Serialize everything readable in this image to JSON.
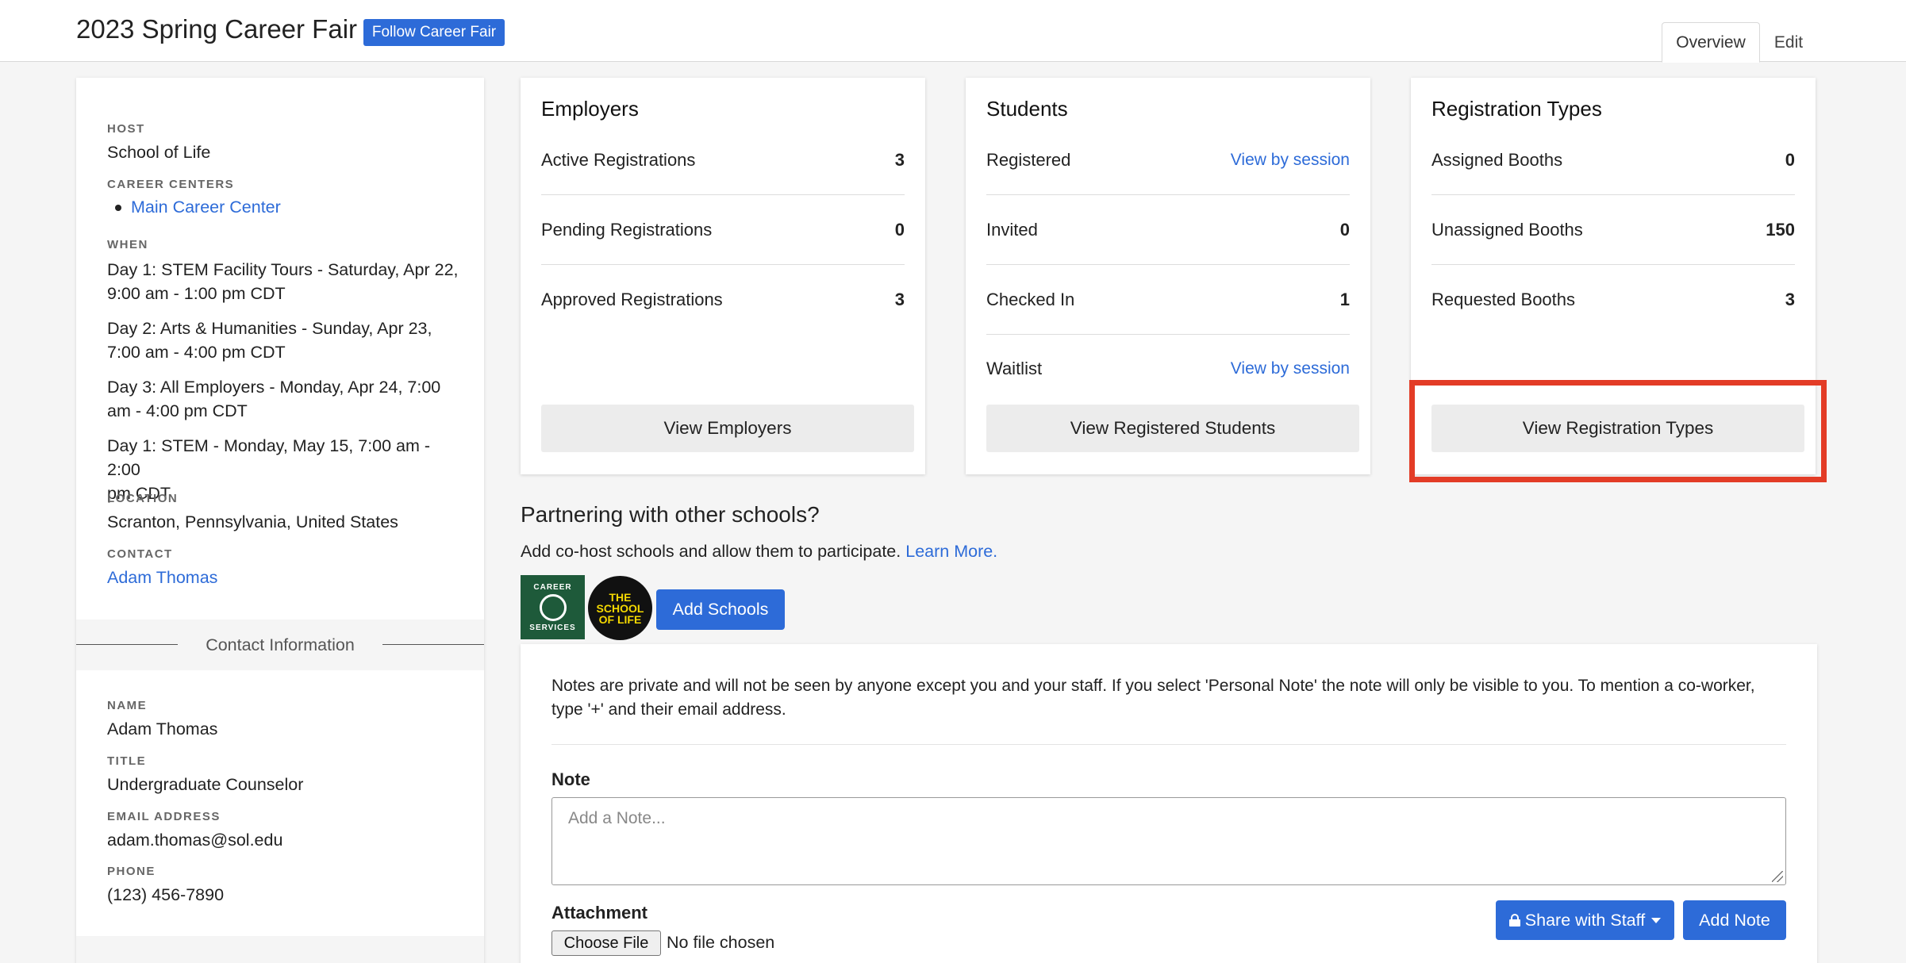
{
  "header": {
    "title": "2023 Spring Career Fair",
    "follow_label": "Follow Career Fair",
    "tabs": [
      {
        "label": "Overview"
      },
      {
        "label": "Edit"
      }
    ]
  },
  "sidebar": {
    "host_label": "HOST",
    "host": "School of Life",
    "career_centers_label": "CAREER CENTERS",
    "career_centers": [
      "Main Career Center"
    ],
    "when_label": "WHEN",
    "when": [
      [
        "Day 1: STEM Facility Tours - Saturday, Apr 22,",
        "9:00 am - 1:00 pm CDT"
      ],
      [
        "Day 2: Arts & Humanities - Sunday, Apr 23,",
        "7:00 am - 4:00 pm CDT"
      ],
      [
        "Day 3: All Employers - Monday, Apr 24, 7:00",
        "am - 4:00 pm CDT"
      ],
      [
        "Day 1: STEM - Monday, May 15, 7:00 am - 2:00",
        "pm CDT"
      ]
    ],
    "location_label": "LOCATION",
    "location": "Scranton, Pennsylvania, United States",
    "contact_label": "CONTACT",
    "contact": "Adam Thomas",
    "contact_info_heading": "Contact Information",
    "name_label": "NAME",
    "name": "Adam Thomas",
    "title_label": "TITLE",
    "title": "Undergraduate Counselor",
    "email_label": "EMAIL ADDRESS",
    "email": "adam.thomas@sol.edu",
    "phone_label": "PHONE",
    "phone": "(123) 456-7890"
  },
  "employers": {
    "title": "Employers",
    "rows": [
      {
        "label": "Active Registrations",
        "value": "3"
      },
      {
        "label": "Pending Registrations",
        "value": "0"
      },
      {
        "label": "Approved Registrations",
        "value": "3"
      }
    ],
    "button": "View Employers"
  },
  "students": {
    "title": "Students",
    "rows": [
      {
        "label": "Registered",
        "link": "View by session"
      },
      {
        "label": "Invited",
        "value": "0"
      },
      {
        "label": "Checked In",
        "value": "1"
      },
      {
        "label": "Waitlist",
        "link": "View by session"
      }
    ],
    "button": "View Registered Students"
  },
  "registration_types": {
    "title": "Registration Types",
    "rows": [
      {
        "label": "Assigned Booths",
        "value": "0"
      },
      {
        "label": "Unassigned Booths",
        "value": "150"
      },
      {
        "label": "Requested Booths",
        "value": "3"
      }
    ],
    "button": "View Registration Types",
    "highlight_color": "#e33c26"
  },
  "partnering": {
    "title": "Partnering with other schools?",
    "subtitle": "Add co-host schools and allow them to participate.",
    "learn_more": "Learn More.",
    "logo1_top": "CAREER",
    "logo1_bottom": "SERVICES",
    "logo2_lines": [
      "THE",
      "SCHOOL",
      "OF LIFE"
    ],
    "add_schools": "Add Schools"
  },
  "notes": {
    "info": "Notes are private and will not be seen by anyone except you and your staff. If you select 'Personal Note' the note will only be visible to you. To mention a co-worker, type '+' and their email address.",
    "note_label": "Note",
    "note_placeholder": "Add a Note...",
    "attachment_label": "Attachment",
    "choose_file": "Choose File",
    "no_file": "No file chosen",
    "share_label": "Share with Staff",
    "add_note": "Add Note"
  },
  "colors": {
    "primary": "#2d6bd8",
    "highlight": "#e33c26",
    "button_grey": "#ececec"
  }
}
